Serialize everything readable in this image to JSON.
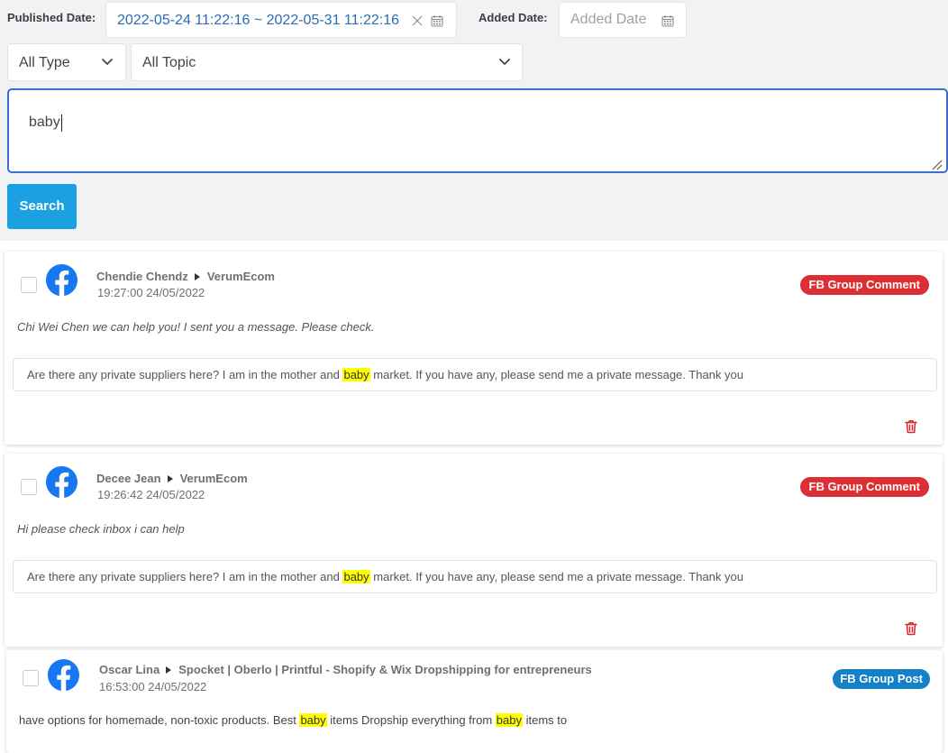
{
  "filters": {
    "published_date": {
      "label": "Published Date:",
      "value": "2022-05-24 11:22:16 ~ 2022-05-31 11:22:16",
      "clear_icon": "clear-icon",
      "calendar_icon": "calendar-icon"
    },
    "added_date": {
      "label": "Added Date:",
      "placeholder": "Added Date",
      "calendar_icon": "calendar-icon"
    },
    "type_select": {
      "selected": "All Type",
      "icon": "chevron-down-icon"
    },
    "topic_select": {
      "selected": "All Topic",
      "icon": "chevron-down-icon"
    }
  },
  "search": {
    "query": "baby",
    "button_label": "Search"
  },
  "results": [
    {
      "author": "Chendie Chendz",
      "group": "VerumEcom",
      "timestamp": "19:27:00 24/05/2022",
      "badge": "FB Group Comment",
      "source_icon": "facebook-icon",
      "comment": "Chi Wei Chen we can help you! I sent you a message. Please check.",
      "parent_post": [
        "Are there any private suppliers here? I am in the mother and ",
        "baby",
        " market. If you have any, please send me a private message. Thank you"
      ],
      "delete_icon": "trash-icon"
    },
    {
      "author": "Decee Jean",
      "group": "VerumEcom",
      "timestamp": "19:26:42 24/05/2022",
      "badge": "FB Group Comment",
      "source_icon": "facebook-icon",
      "comment": "Hi please check inbox i can help",
      "parent_post": [
        "Are there any private suppliers here? I am in the mother and ",
        "baby",
        " market. If you have any, please send me a private message. Thank you"
      ],
      "delete_icon": "trash-icon"
    },
    {
      "author": "Oscar Lina",
      "group": "Spocket | Oberlo | Printful - Shopify & Wix Dropshipping for entrepreneurs",
      "timestamp": "16:53:00 24/05/2022",
      "badge": "FB Group Post",
      "source_icon": "facebook-icon",
      "content": [
        "have options for homemade, non-toxic products. Best ",
        "baby",
        " items Dropship everything from ",
        "baby",
        " items to"
      ]
    }
  ],
  "colors": {
    "page_bg": "#f1f2f4",
    "date_text": "#2b6cb5",
    "focus_border": "#3a6fd8",
    "search_button": "#1ba1e2",
    "comment_badge": "#dc2f34",
    "post_badge": "#1480c6",
    "highlight": "#ffff00",
    "facebook": "#1877f2",
    "delete": "#e02424"
  }
}
